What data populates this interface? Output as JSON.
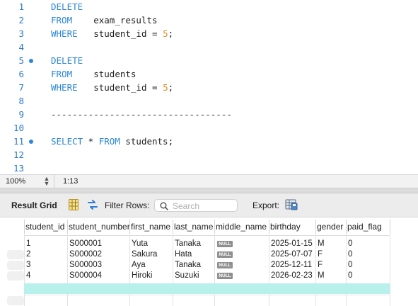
{
  "editor": {
    "lines": [
      {
        "num": "1",
        "marker": false,
        "segments": [
          {
            "t": "DELETE",
            "c": "kw"
          }
        ]
      },
      {
        "num": "2",
        "marker": false,
        "segments": [
          {
            "t": "FROM",
            "c": "kw"
          },
          {
            "t": "    exam_results",
            "c": ""
          }
        ]
      },
      {
        "num": "3",
        "marker": false,
        "segments": [
          {
            "t": "WHERE",
            "c": "kw"
          },
          {
            "t": "   student_id = ",
            "c": ""
          },
          {
            "t": "5",
            "c": "num"
          },
          {
            "t": ";",
            "c": ""
          }
        ]
      },
      {
        "num": "4",
        "marker": false,
        "segments": []
      },
      {
        "num": "5",
        "marker": true,
        "segments": [
          {
            "t": "DELETE",
            "c": "kw"
          }
        ]
      },
      {
        "num": "6",
        "marker": false,
        "segments": [
          {
            "t": "FROM",
            "c": "kw"
          },
          {
            "t": "    students",
            "c": ""
          }
        ]
      },
      {
        "num": "7",
        "marker": false,
        "segments": [
          {
            "t": "WHERE",
            "c": "kw"
          },
          {
            "t": "   student_id = ",
            "c": ""
          },
          {
            "t": "5",
            "c": "num"
          },
          {
            "t": ";",
            "c": ""
          }
        ]
      },
      {
        "num": "8",
        "marker": false,
        "segments": []
      },
      {
        "num": "9",
        "marker": false,
        "segments": [
          {
            "t": "----------------------------------",
            "c": "dash"
          }
        ]
      },
      {
        "num": "10",
        "marker": false,
        "segments": []
      },
      {
        "num": "11",
        "marker": true,
        "segments": [
          {
            "t": "SELECT",
            "c": "kw"
          },
          {
            "t": " * ",
            "c": ""
          },
          {
            "t": "FROM",
            "c": "kw"
          },
          {
            "t": " students;",
            "c": ""
          }
        ]
      },
      {
        "num": "12",
        "marker": false,
        "segments": []
      },
      {
        "num": "13",
        "marker": false,
        "segments": []
      }
    ]
  },
  "status_bar": {
    "zoom": "100%",
    "cursor_position": "1:13"
  },
  "result_toolbar": {
    "title": "Result Grid",
    "filter_label": "Filter Rows:",
    "search_placeholder": "Search",
    "export_label": "Export:"
  },
  "grid": {
    "columns": [
      "student_id",
      "student_number",
      "first_name",
      "last_name",
      "middle_name",
      "birthday",
      "gender",
      "paid_flag"
    ],
    "null_label": "NULL",
    "rows": [
      [
        "1",
        "S000001",
        "Yuta",
        "Tanaka",
        null,
        "2025-01-15",
        "M",
        "0"
      ],
      [
        "2",
        "S000002",
        "Sakura",
        "Hata",
        null,
        "2025-07-07",
        "F",
        "0"
      ],
      [
        "3",
        "S000003",
        "Aya",
        "Tanaka",
        null,
        "2025-12-11",
        "F",
        "0"
      ],
      [
        "4",
        "S000004",
        "Hiroki",
        "Suzuki",
        null,
        "2026-02-23",
        "M",
        "0"
      ]
    ]
  },
  "colors": {
    "keyword": "#2a86d6",
    "number": "#e08b1f",
    "line_number": "#2b7bd0",
    "new_row_highlight": "#b8f1ec",
    "null_badge": "#8f8f8f"
  }
}
